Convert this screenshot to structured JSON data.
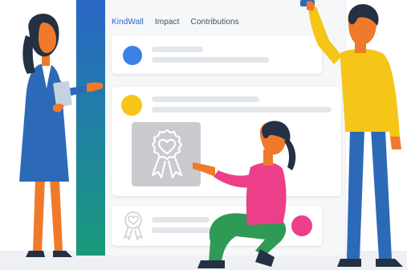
{
  "nav": {
    "items": [
      {
        "label": "KindWall",
        "active": true
      },
      {
        "label": "Impact",
        "active": false
      },
      {
        "label": "Contributions",
        "active": false
      }
    ]
  },
  "colors": {
    "accent_blue": "#2a63c5",
    "rail_gradient_top": "#2a66c6",
    "rail_gradient_bottom": "#1a9a7a",
    "post_dot_1": "#3b82e6",
    "post_dot_2": "#f5c518",
    "post_dot_3": "#ec3f8a",
    "placeholder_bar": "#e3e6ea",
    "badge_frame": "#c9cbcf"
  },
  "icons": {
    "badge": "heart-ribbon-badge-icon",
    "small_badge": "small-heart-ribbon-icon"
  },
  "people": [
    {
      "role": "woman-holding-tablet",
      "outfit": "blue-dress"
    },
    {
      "role": "man-pinning-note",
      "outfit": "yellow-sweater"
    },
    {
      "role": "woman-kneeling-pointing",
      "outfit": "pink-top"
    }
  ]
}
